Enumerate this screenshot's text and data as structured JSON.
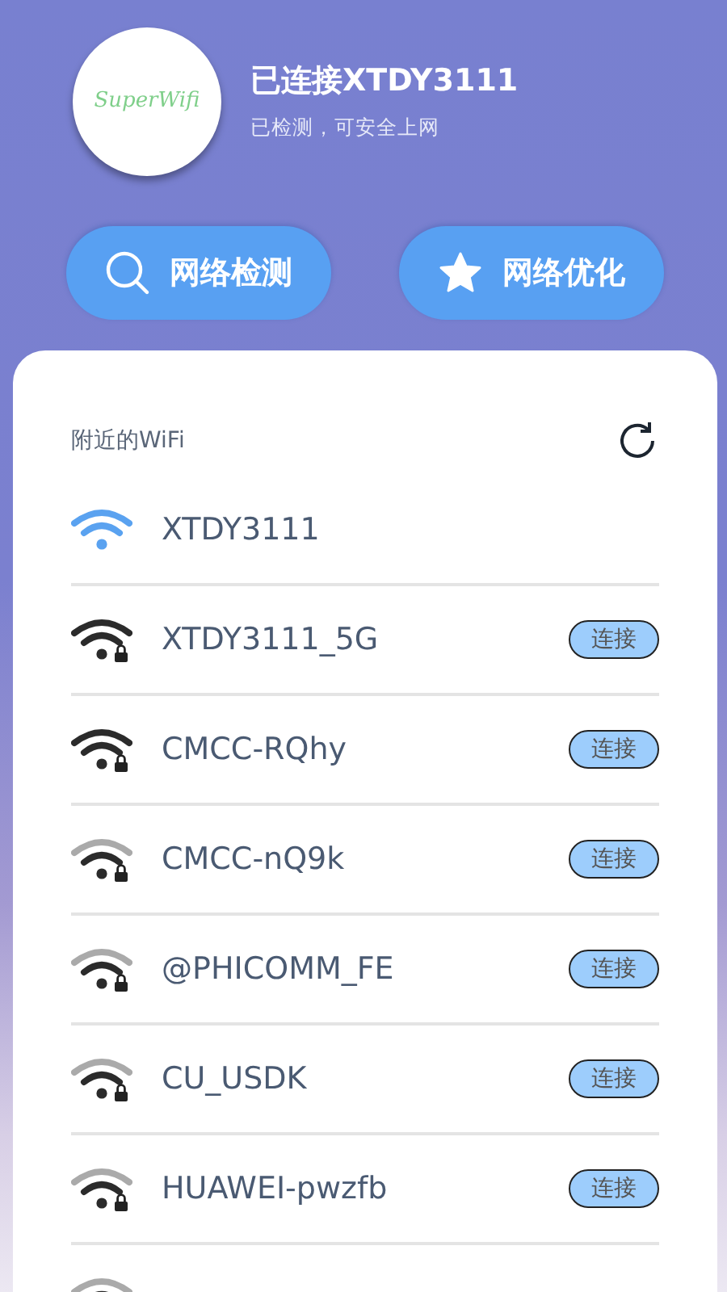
{
  "header": {
    "logo_text": "SuperWifi",
    "title": "已连接XTDY3111",
    "subtitle": "已检测，可安全上网"
  },
  "actions": [
    {
      "kind": "search",
      "label": "网络检测"
    },
    {
      "kind": "star",
      "label": "网络优化"
    }
  ],
  "nearby": {
    "title": "附近的WiFi",
    "networks": [
      {
        "kind": "connected",
        "name": "XTDY3111"
      },
      {
        "kind": "strong",
        "name": "XTDY3111_5G",
        "action": "连接"
      },
      {
        "kind": "strong",
        "name": "CMCC-RQhy",
        "action": "连接"
      },
      {
        "kind": "medium",
        "name": "CMCC-nQ9k",
        "action": "连接"
      },
      {
        "kind": "medium",
        "name": "@PHICOMM_FE",
        "action": "连接"
      },
      {
        "kind": "medium",
        "name": "CU_USDK",
        "action": "连接"
      },
      {
        "kind": "medium",
        "name": "HUAWEI-pwzfb",
        "action": "连接"
      },
      {
        "kind": "medium"
      }
    ]
  }
}
